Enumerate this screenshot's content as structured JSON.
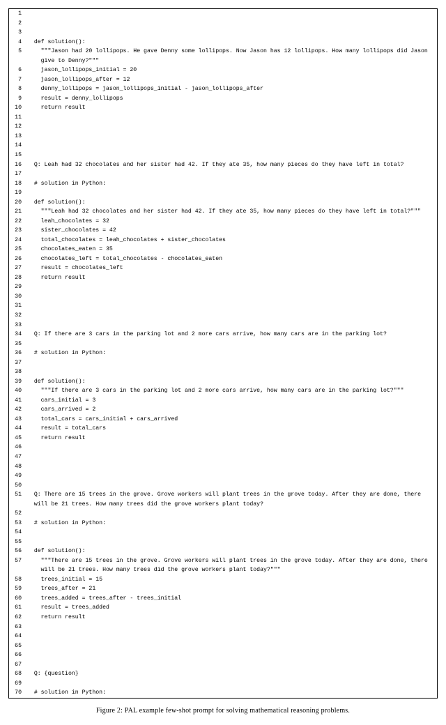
{
  "caption": "Figure 2: PAL example few-shot prompt for solving mathematical reasoning problems.",
  "lines": [
    {
      "n": "1",
      "indent": 0,
      "text": ""
    },
    {
      "n": "2",
      "indent": 0,
      "text": ""
    },
    {
      "n": "3",
      "indent": 0,
      "text": ""
    },
    {
      "n": "4",
      "indent": 1,
      "text": "def solution():"
    },
    {
      "n": "5",
      "indent": 2,
      "text": "\"\"\"Jason had 20 lollipops. He gave Denny some lollipops. Now Jason has 12 lollipops. How many lollipops did Jason give to Denny?\"\"\""
    },
    {
      "n": "6",
      "indent": 2,
      "text": "jason_lollipops_initial = 20"
    },
    {
      "n": "7",
      "indent": 2,
      "text": "jason_lollipops_after = 12"
    },
    {
      "n": "8",
      "indent": 2,
      "text": "denny_lollipops = jason_lollipops_initial - jason_lollipops_after"
    },
    {
      "n": "9",
      "indent": 2,
      "text": "result = denny_lollipops"
    },
    {
      "n": "10",
      "indent": 2,
      "text": "return result"
    },
    {
      "n": "11",
      "indent": 0,
      "text": ""
    },
    {
      "n": "12",
      "indent": 0,
      "text": ""
    },
    {
      "n": "13",
      "indent": 0,
      "text": ""
    },
    {
      "n": "14",
      "indent": 0,
      "text": ""
    },
    {
      "n": "15",
      "indent": 0,
      "text": ""
    },
    {
      "n": "16",
      "indent": 1,
      "text": "Q: Leah had 32 chocolates and her sister had 42. If they ate 35, how many pieces do they have left in total?"
    },
    {
      "n": "17",
      "indent": 0,
      "text": ""
    },
    {
      "n": "18",
      "indent": 1,
      "text": "# solution in Python:"
    },
    {
      "n": "19",
      "indent": 0,
      "text": ""
    },
    {
      "n": "20",
      "indent": 1,
      "text": "def solution():"
    },
    {
      "n": "21",
      "indent": 2,
      "text": "\"\"\"Leah had 32 chocolates and her sister had 42. If they ate 35, how many pieces do they have left in total?\"\"\""
    },
    {
      "n": "22",
      "indent": 2,
      "text": "leah_chocolates = 32"
    },
    {
      "n": "23",
      "indent": 2,
      "text": "sister_chocolates = 42"
    },
    {
      "n": "24",
      "indent": 2,
      "text": "total_chocolates = leah_chocolates + sister_chocolates"
    },
    {
      "n": "25",
      "indent": 2,
      "text": "chocolates_eaten = 35"
    },
    {
      "n": "26",
      "indent": 2,
      "text": "chocolates_left = total_chocolates - chocolates_eaten"
    },
    {
      "n": "27",
      "indent": 2,
      "text": "result = chocolates_left"
    },
    {
      "n": "28",
      "indent": 2,
      "text": "return result"
    },
    {
      "n": "29",
      "indent": 0,
      "text": ""
    },
    {
      "n": "30",
      "indent": 0,
      "text": ""
    },
    {
      "n": "31",
      "indent": 0,
      "text": ""
    },
    {
      "n": "32",
      "indent": 0,
      "text": ""
    },
    {
      "n": "33",
      "indent": 0,
      "text": ""
    },
    {
      "n": "34",
      "indent": 1,
      "text": "Q: If there are 3 cars in the parking lot and 2 more cars arrive, how many cars are in the parking lot?"
    },
    {
      "n": "35",
      "indent": 0,
      "text": ""
    },
    {
      "n": "36",
      "indent": 1,
      "text": "# solution in Python:"
    },
    {
      "n": "37",
      "indent": 0,
      "text": ""
    },
    {
      "n": "38",
      "indent": 0,
      "text": ""
    },
    {
      "n": "39",
      "indent": 1,
      "text": "def solution():"
    },
    {
      "n": "40",
      "indent": 2,
      "text": "\"\"\"If there are 3 cars in the parking lot and 2 more cars arrive, how many cars are in the parking lot?\"\"\""
    },
    {
      "n": "41",
      "indent": 2,
      "text": "cars_initial = 3"
    },
    {
      "n": "42",
      "indent": 2,
      "text": "cars_arrived = 2"
    },
    {
      "n": "43",
      "indent": 2,
      "text": "total_cars = cars_initial + cars_arrived"
    },
    {
      "n": "44",
      "indent": 2,
      "text": "result = total_cars"
    },
    {
      "n": "45",
      "indent": 2,
      "text": "return result"
    },
    {
      "n": "46",
      "indent": 0,
      "text": ""
    },
    {
      "n": "47",
      "indent": 0,
      "text": ""
    },
    {
      "n": "48",
      "indent": 0,
      "text": ""
    },
    {
      "n": "49",
      "indent": 0,
      "text": ""
    },
    {
      "n": "50",
      "indent": 0,
      "text": ""
    },
    {
      "n": "51",
      "indent": 1,
      "text": "Q: There are 15 trees in the grove. Grove workers will plant trees in the grove today. After they are done, there will be 21 trees. How many trees did the grove workers plant today?"
    },
    {
      "n": "52",
      "indent": 0,
      "text": ""
    },
    {
      "n": "53",
      "indent": 1,
      "text": "# solution in Python:"
    },
    {
      "n": "54",
      "indent": 0,
      "text": ""
    },
    {
      "n": "55",
      "indent": 0,
      "text": ""
    },
    {
      "n": "56",
      "indent": 1,
      "text": "def solution():"
    },
    {
      "n": "57",
      "indent": 2,
      "text": "\"\"\"There are 15 trees in the grove. Grove workers will plant trees in the grove today. After they are done, there will be 21 trees. How many trees did the grove workers plant today?\"\"\""
    },
    {
      "n": "58",
      "indent": 2,
      "text": "trees_initial = 15"
    },
    {
      "n": "59",
      "indent": 2,
      "text": "trees_after = 21"
    },
    {
      "n": "60",
      "indent": 2,
      "text": "trees_added = trees_after - trees_initial"
    },
    {
      "n": "61",
      "indent": 2,
      "text": "result = trees_added"
    },
    {
      "n": "62",
      "indent": 2,
      "text": "return result"
    },
    {
      "n": "63",
      "indent": 0,
      "text": ""
    },
    {
      "n": "64",
      "indent": 0,
      "text": ""
    },
    {
      "n": "65",
      "indent": 0,
      "text": ""
    },
    {
      "n": "66",
      "indent": 0,
      "text": ""
    },
    {
      "n": "67",
      "indent": 0,
      "text": ""
    },
    {
      "n": "68",
      "indent": 1,
      "text": "Q: {question}"
    },
    {
      "n": "69",
      "indent": 0,
      "text": ""
    },
    {
      "n": "70",
      "indent": 1,
      "text": "# solution in Python:"
    }
  ]
}
